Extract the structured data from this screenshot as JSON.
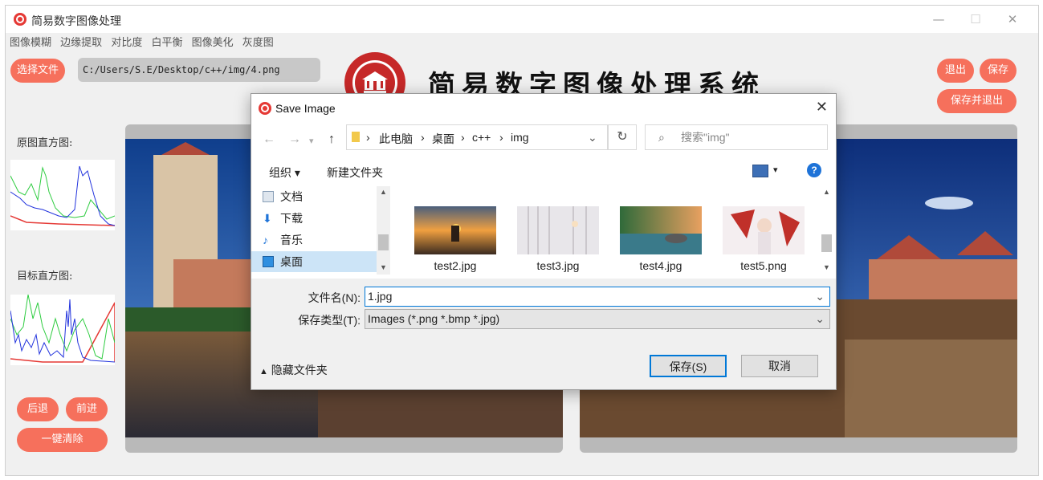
{
  "window": {
    "title": "简易数字图像处理",
    "controls": {
      "minimize": "—",
      "maximize": "☐",
      "close": "✕"
    }
  },
  "menu": [
    "图像模糊",
    "边缘提取",
    "对比度",
    "白平衡",
    "图像美化",
    "灰度图"
  ],
  "toolbar": {
    "select_file": "选择文件",
    "path": "C:/Users/S.E/Desktop/c++/img/4.png",
    "exit": "退出",
    "save": "保存",
    "save_and_exit": "保存并退出"
  },
  "app_title": "简易数字图像处理系统",
  "histograms": {
    "original_label": "原图直方图:",
    "target_label": "目标直方图:"
  },
  "bottom_buttons": {
    "back": "后退",
    "forward": "前进",
    "clear": "一键清除"
  },
  "colors": {
    "accent": "#f6705c",
    "panel": "#b9b9b9",
    "dialog_primary_border": "#0078d7"
  },
  "dialog": {
    "title": "Save Image",
    "close": "✕",
    "nav": {
      "back": "←",
      "forward": "→",
      "up": "↑"
    },
    "breadcrumb": [
      "此电脑",
      "桌面",
      "c++",
      "img"
    ],
    "search_placeholder": "搜索\"img\"",
    "organize": "组织 ▾",
    "new_folder": "新建文件夹",
    "help": "?",
    "nav_items": [
      {
        "label": "文档",
        "icon": "document-icon"
      },
      {
        "label": "下载",
        "icon": "download-icon"
      },
      {
        "label": "音乐",
        "icon": "music-icon"
      },
      {
        "label": "桌面",
        "icon": "desktop-icon",
        "selected": true
      }
    ],
    "files": [
      "test2.jpg",
      "test3.jpg",
      "test4.jpg",
      "test5.png"
    ],
    "filename_label": "文件名(N):",
    "filename_value": "1.jpg",
    "filetype_label": "保存类型(T):",
    "filetype_value": "Images (*.png *.bmp *.jpg)",
    "hide_folders": "隐藏文件夹",
    "save_button": "保存(S)",
    "cancel_button": "取消"
  }
}
